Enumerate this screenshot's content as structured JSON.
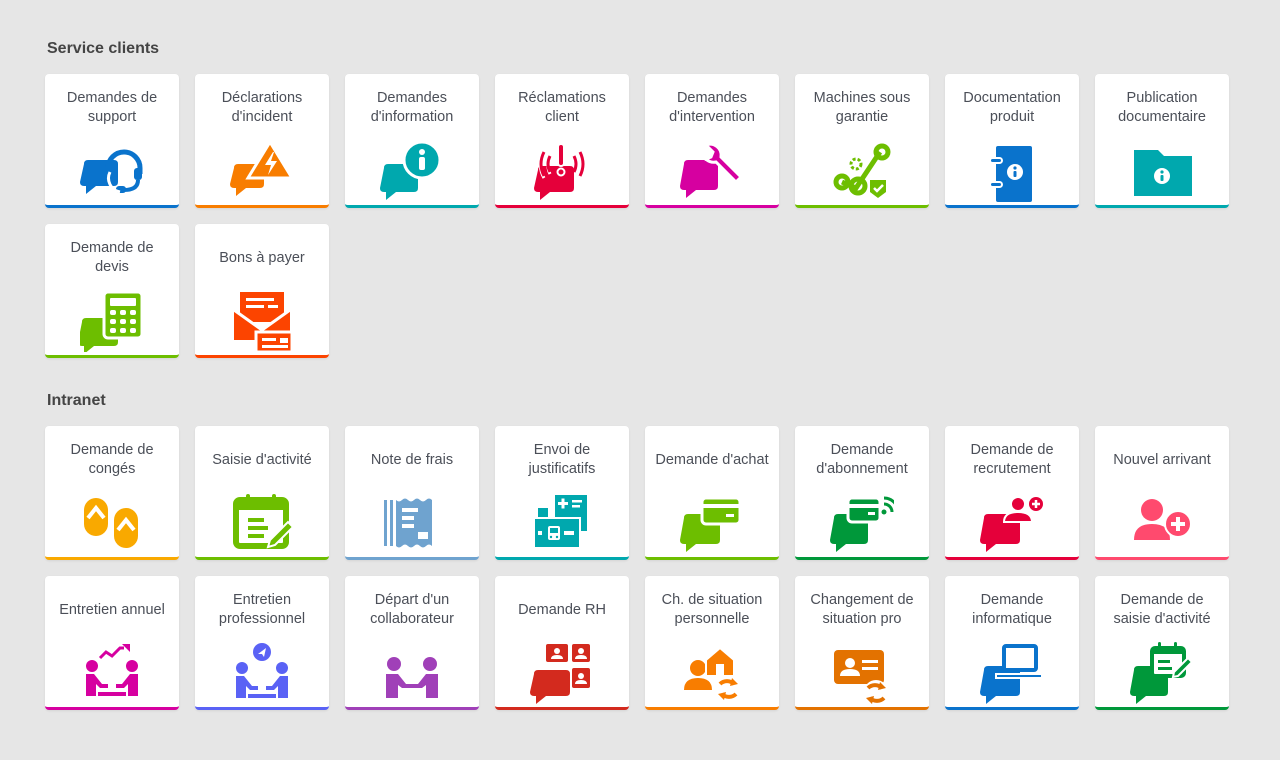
{
  "sections": [
    {
      "title": "Service clients",
      "tiles": [
        {
          "label": "Demandes de support",
          "icon": "headset-chat-icon",
          "color": "#0a73cc"
        },
        {
          "label": "Déclarations d'incident",
          "icon": "incident-chat-icon",
          "color": "#f87d00"
        },
        {
          "label": "Demandes d'information",
          "icon": "info-chat-icon",
          "color": "#00a8ae"
        },
        {
          "label": "Réclamations client",
          "icon": "alert-chat-icon",
          "color": "#e5003a"
        },
        {
          "label": "Demandes d'intervention",
          "icon": "wrench-chat-icon",
          "color": "#d600a0"
        },
        {
          "label": "Machines sous garantie",
          "icon": "warranty-machine-icon",
          "color": "#6dbe00"
        },
        {
          "label": "Documentation produit",
          "icon": "info-notebook-icon",
          "color": "#0a73cc"
        },
        {
          "label": "Publication documentaire",
          "icon": "info-folder-icon",
          "color": "#00a8ae"
        },
        {
          "label": "Demande de devis",
          "icon": "calculator-chat-icon",
          "color": "#6dbe00"
        },
        {
          "label": "Bons à payer",
          "icon": "envelope-payment-icon",
          "color": "#fc4400"
        }
      ]
    },
    {
      "title": "Intranet",
      "tiles": [
        {
          "label": "Demande de congés",
          "icon": "flip-flops-icon",
          "color": "#f9a900"
        },
        {
          "label": "Saisie d'activité",
          "icon": "calendar-edit-icon",
          "color": "#6dbe00"
        },
        {
          "label": "Note de frais",
          "icon": "receipt-icon",
          "color": "#6fa3cf"
        },
        {
          "label": "Envoi de justificatifs",
          "icon": "justificatifs-icon",
          "color": "#00a8ae"
        },
        {
          "label": "Demande d'achat",
          "icon": "card-chat-icon",
          "color": "#6dbe00"
        },
        {
          "label": "Demande d'abonnement",
          "icon": "subscription-chat-icon",
          "color": "#00983a"
        },
        {
          "label": "Demande de recrutement",
          "icon": "recruit-chat-icon",
          "color": "#e5003a"
        },
        {
          "label": "Nouvel arrivant",
          "icon": "user-add-icon",
          "color": "#ff4a6e"
        },
        {
          "label": "Entretien annuel",
          "icon": "annual-meeting-icon",
          "color": "#d600a0"
        },
        {
          "label": "Entretien professionnel",
          "icon": "pro-meeting-icon",
          "color": "#5a62f5"
        },
        {
          "label": "Départ d'un collaborateur",
          "icon": "handshake-icon",
          "color": "#a040b8"
        },
        {
          "label": "Demande RH",
          "icon": "hr-puzzle-icon",
          "color": "#d32a1e"
        },
        {
          "label": "Ch. de situation personnelle",
          "icon": "personal-change-icon",
          "color": "#f87d00"
        },
        {
          "label": "Changement de situation pro",
          "icon": "pro-change-icon",
          "color": "#e37200"
        },
        {
          "label": "Demande informatique",
          "icon": "laptop-chat-icon",
          "color": "#0a73cc"
        },
        {
          "label": "Demande de saisie d'activité",
          "icon": "calendar-chat-icon",
          "color": "#00983a"
        }
      ]
    }
  ]
}
